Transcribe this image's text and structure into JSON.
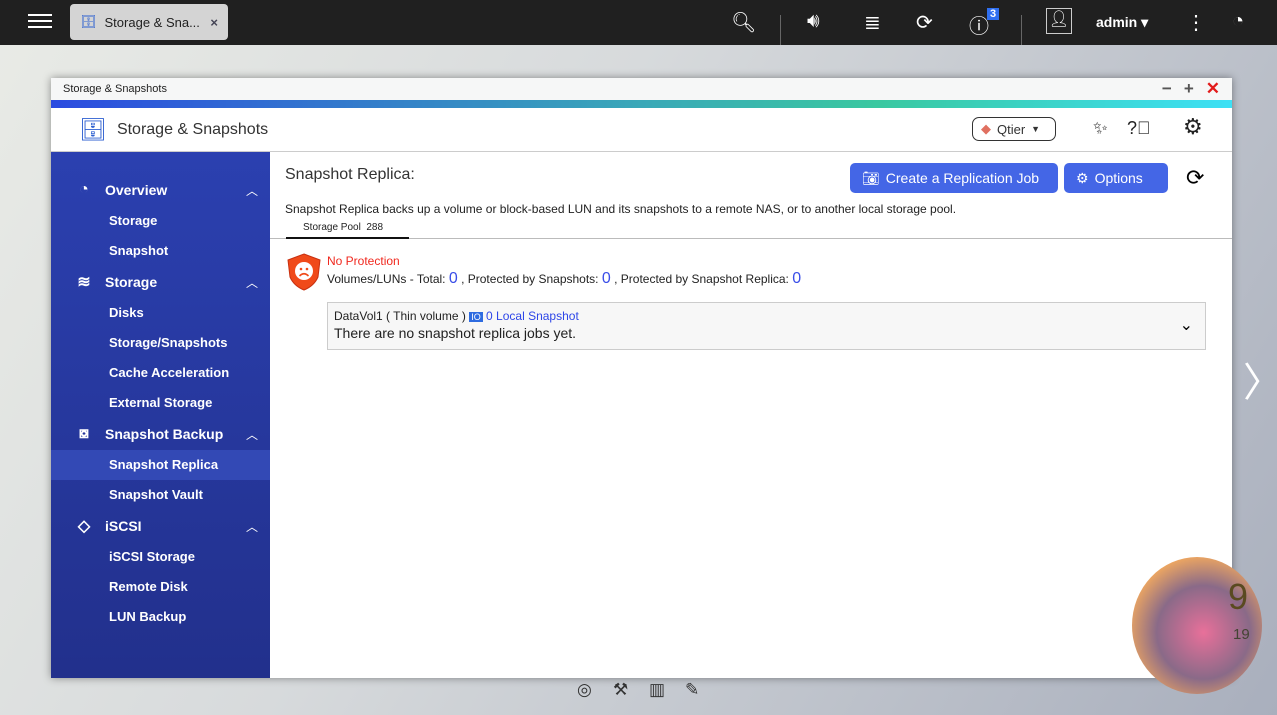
{
  "topbar": {
    "tab_title": "Storage & Sna...",
    "tab_close": "×",
    "notification_count": "3",
    "user": "admin"
  },
  "window": {
    "title": "Storage & Snapshots",
    "app_title": "Storage & Snapshots",
    "qtier_label": "Qtier"
  },
  "sidebar": {
    "groups": [
      {
        "label": "Overview",
        "items": [
          "Storage",
          "Snapshot"
        ]
      },
      {
        "label": "Storage",
        "items": [
          "Disks",
          "Storage/Snapshots",
          "Cache Acceleration",
          "External Storage"
        ]
      },
      {
        "label": "Snapshot Backup",
        "items": [
          "Snapshot Replica",
          "Snapshot Vault"
        ]
      },
      {
        "label": "iSCSI",
        "items": [
          "iSCSI Storage",
          "Remote Disk",
          "LUN Backup"
        ]
      }
    ],
    "active": "Snapshot Replica"
  },
  "main": {
    "title": "Snapshot Replica:",
    "create_button": "Create a Replication Job",
    "options_button": "Options",
    "description": "Snapshot Replica backs up a volume or block-based LUN and its snapshots to a remote NAS, or to another local storage pool.",
    "tab": "Storage Pool  288",
    "status": "No Protection",
    "stats": {
      "prefix": "Volumes/LUNs - Total:",
      "total": "0",
      "snap_label": ", Protected by Snapshots:",
      "snap": "0",
      "replica_label": ", Protected by Snapshot Replica:",
      "replica": "0"
    },
    "volume": {
      "name": "DataVol1 ( Thin volume )",
      "snapshot_link": "0 Local Snapshot",
      "message": "There are no snapshot replica jobs yet."
    }
  },
  "widget": {
    "day": "9",
    "hour": "19"
  }
}
